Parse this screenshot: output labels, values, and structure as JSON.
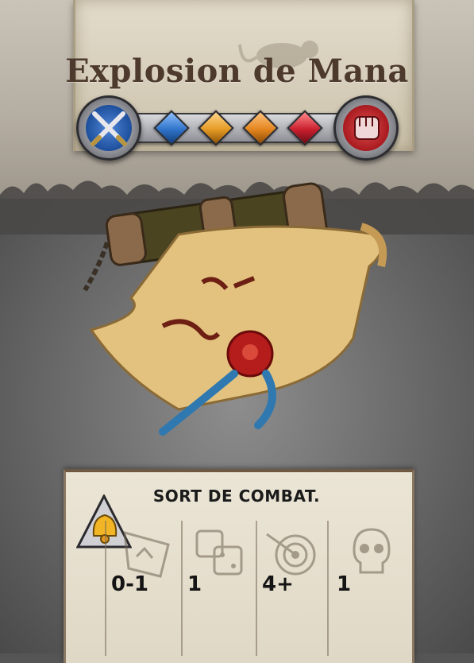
{
  "card": {
    "title": "Explosion de Mana",
    "spell_type": "SORT DE COMBAT."
  },
  "stat_bar": {
    "left_emblem": "crossed-swords-icon",
    "right_emblem": "fist-icon",
    "gems": [
      {
        "name": "blue-gem-icon",
        "color": "#2f73c9"
      },
      {
        "name": "orange-gem-icon",
        "color": "#e59a24"
      },
      {
        "name": "orange-gem-icon",
        "color": "#e3851f"
      },
      {
        "name": "red-gem-icon",
        "color": "#c91f2e"
      }
    ]
  },
  "stats": [
    {
      "icon": "range-map-icon",
      "value": "0-1"
    },
    {
      "icon": "dice-icon",
      "value": "1"
    },
    {
      "icon": "target-arrow-icon",
      "value": "4+"
    },
    {
      "icon": "skull-icon",
      "value": "1"
    }
  ],
  "class_badge": {
    "icon": "bell-icon"
  },
  "colors": {
    "title": "#4d3a2c",
    "parchment": "#e3dccb",
    "stone": "#6f6f6f"
  }
}
